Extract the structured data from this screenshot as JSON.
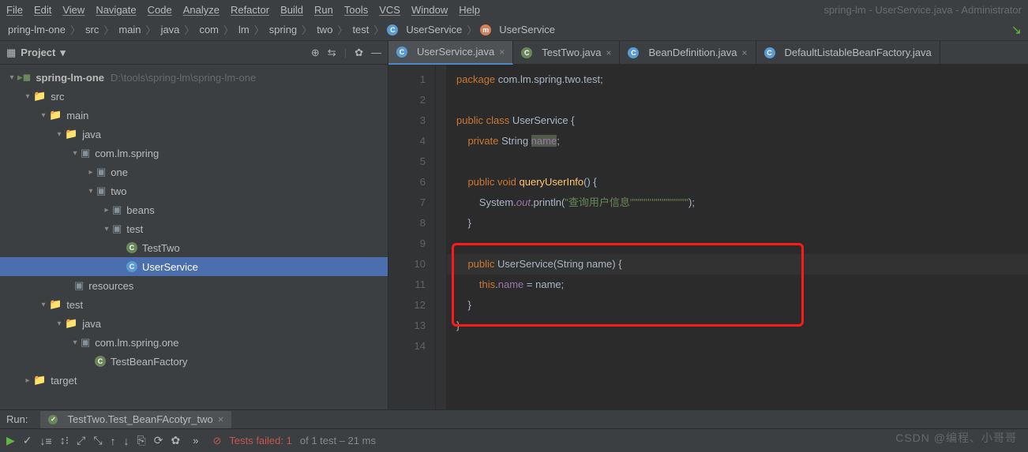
{
  "menu": [
    "File",
    "Edit",
    "View",
    "Navigate",
    "Code",
    "Analyze",
    "Refactor",
    "Build",
    "Run",
    "Tools",
    "VCS",
    "Window",
    "Help"
  ],
  "window_title": "spring-lm - UserService.java - Administrator",
  "breadcrumb": [
    "pring-lm-one",
    "src",
    "main",
    "java",
    "com",
    "lm",
    "spring",
    "two",
    "test",
    "UserService",
    "UserService"
  ],
  "sidebar": {
    "title": "Project",
    "root": "spring-lm-one",
    "root_path": "D:\\tools\\spring-lm\\spring-lm-one",
    "tree": {
      "src": "src",
      "main": "main",
      "java": "java",
      "pkg1": "com.lm.spring",
      "one": "one",
      "two": "two",
      "beans": "beans",
      "test": "test",
      "TestTwo": "TestTwo",
      "UserService": "UserService",
      "resources": "resources",
      "test2": "test",
      "java2": "java",
      "pkg2": "com.lm.spring.one",
      "TestBeanFactory": "TestBeanFactory",
      "target": "target"
    }
  },
  "tabs": [
    {
      "label": "UserService.java",
      "active": true,
      "icon": "c"
    },
    {
      "label": "TestTwo.java",
      "active": false,
      "icon": "tst"
    },
    {
      "label": "BeanDefinition.java",
      "active": false,
      "icon": "c"
    },
    {
      "label": "DefaultListableBeanFactory.java",
      "active": false,
      "icon": "c"
    }
  ],
  "code": {
    "line1": {
      "kw": "package",
      "rest": " com.lm.spring.two.test;"
    },
    "line3": {
      "kw1": "public class ",
      "cls": "UserService",
      "rest": " {"
    },
    "line4": {
      "kw": "private ",
      "type": "String ",
      "fld": "name",
      "semi": ";"
    },
    "line6": {
      "kw": "public void ",
      "mth": "queryUserInfo",
      "rest": "() {"
    },
    "line7": {
      "pre": "        System.",
      "out": "out",
      "mid": ".println(",
      "str": "\"查询用户信息''''''''''''''''''''''''''''\"",
      "end": ");"
    },
    "line8": "    }",
    "line10": {
      "kw": "public ",
      "ctor": "UserService",
      "rest": "(String name) {"
    },
    "line11": {
      "pre": "        ",
      "this": "this",
      "dot": ".",
      "fld": "name",
      "eq": " = name;"
    },
    "line12": "    }",
    "line13": "}"
  },
  "line_numbers": [
    "1",
    "2",
    "3",
    "4",
    "5",
    "6",
    "7",
    "8",
    "9",
    "10",
    "11",
    "12",
    "13",
    "14"
  ],
  "run": {
    "label": "Run:",
    "tab": "TestTwo.Test_BeanFAcotyr_two"
  },
  "bottom": {
    "fail": "Tests failed: 1",
    "rest": " of 1 test – 21 ms"
  },
  "watermark": "CSDN @编程、小哥哥"
}
